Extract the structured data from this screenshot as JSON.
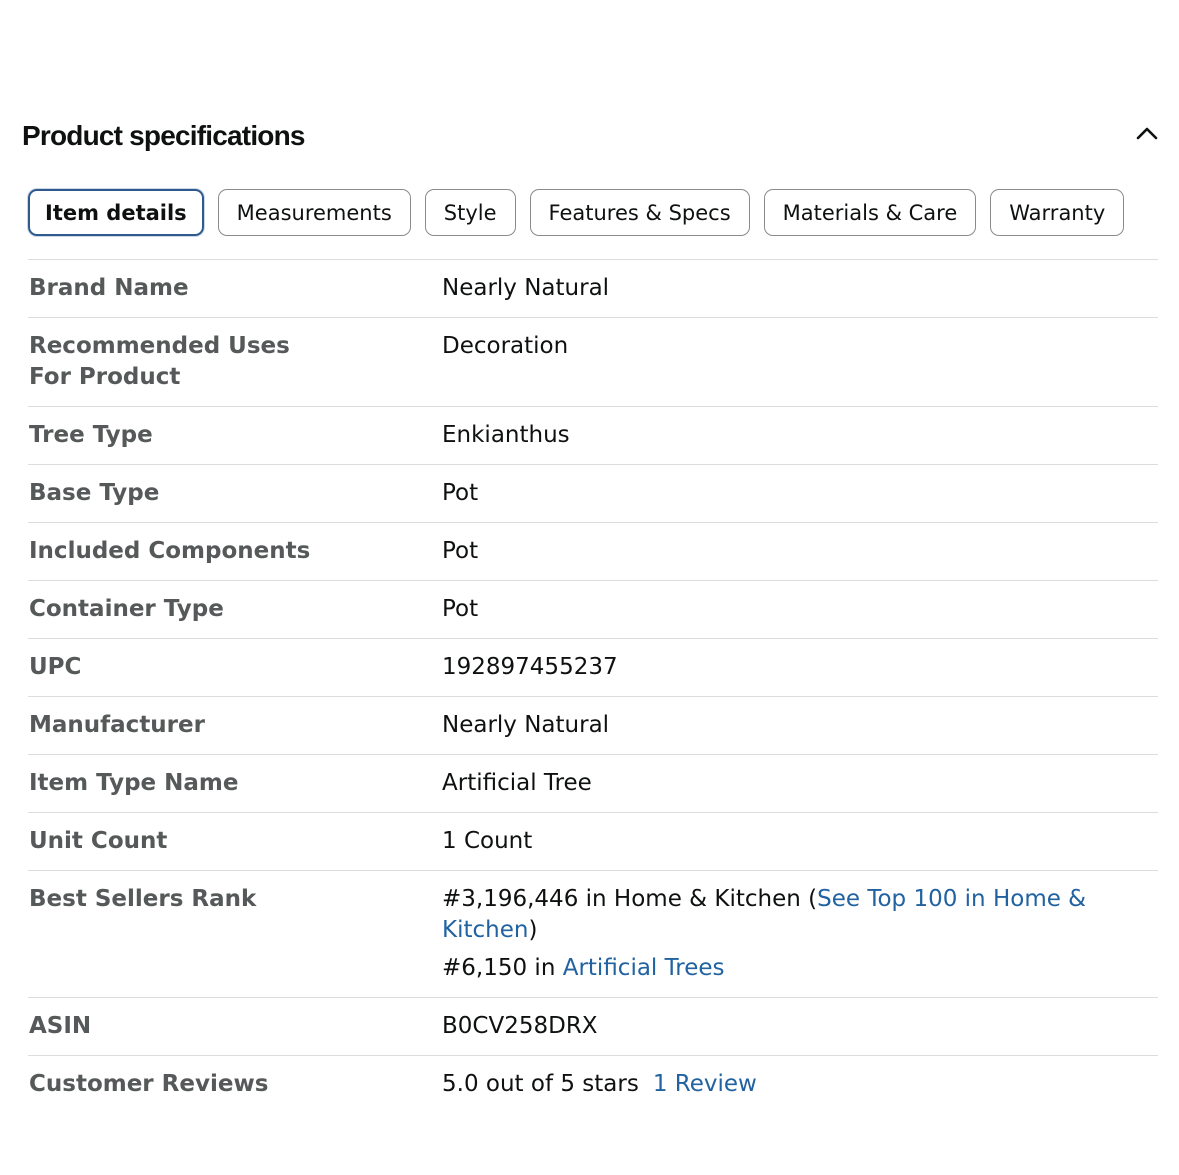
{
  "section": {
    "title": "Product specifications"
  },
  "tabs": [
    {
      "label": "Item details",
      "active": true
    },
    {
      "label": "Measurements",
      "active": false
    },
    {
      "label": "Style",
      "active": false
    },
    {
      "label": "Features & Specs",
      "active": false
    },
    {
      "label": "Materials & Care",
      "active": false
    },
    {
      "label": "Warranty",
      "active": false
    }
  ],
  "rows": {
    "brand_name": {
      "label": "Brand Name",
      "value": "Nearly Natural"
    },
    "recommended_uses": {
      "label": "Recommended Uses For Product",
      "value": "Decoration"
    },
    "tree_type": {
      "label": "Tree Type",
      "value": "Enkianthus"
    },
    "base_type": {
      "label": "Base Type",
      "value": "Pot"
    },
    "included_components": {
      "label": "Included Components",
      "value": "Pot"
    },
    "container_type": {
      "label": "Container Type",
      "value": "Pot"
    },
    "upc": {
      "label": "UPC",
      "value": "192897455237"
    },
    "manufacturer": {
      "label": "Manufacturer",
      "value": "Nearly Natural"
    },
    "item_type_name": {
      "label": "Item Type Name",
      "value": "Artificial Tree"
    },
    "unit_count": {
      "label": "Unit Count",
      "value": "1 Count"
    },
    "best_sellers_rank": {
      "label": "Best Sellers Rank",
      "rank1_text": "#3,196,446 in Home & Kitchen (",
      "rank1_link": "See Top 100 in Home & Kitchen",
      "rank1_close": ")",
      "rank2_text": "#6,150 in ",
      "rank2_link": "Artificial Trees"
    },
    "asin": {
      "label": "ASIN",
      "value": "B0CV258DRX"
    },
    "customer_reviews": {
      "label": "Customer Reviews",
      "value": "5.0 out of 5 stars",
      "review_link": "1 Review"
    }
  },
  "colors": {
    "link": "#2162a1",
    "active_tab_border": "#2f5a8c",
    "label_text": "#565959",
    "divider": "#dddddd"
  }
}
